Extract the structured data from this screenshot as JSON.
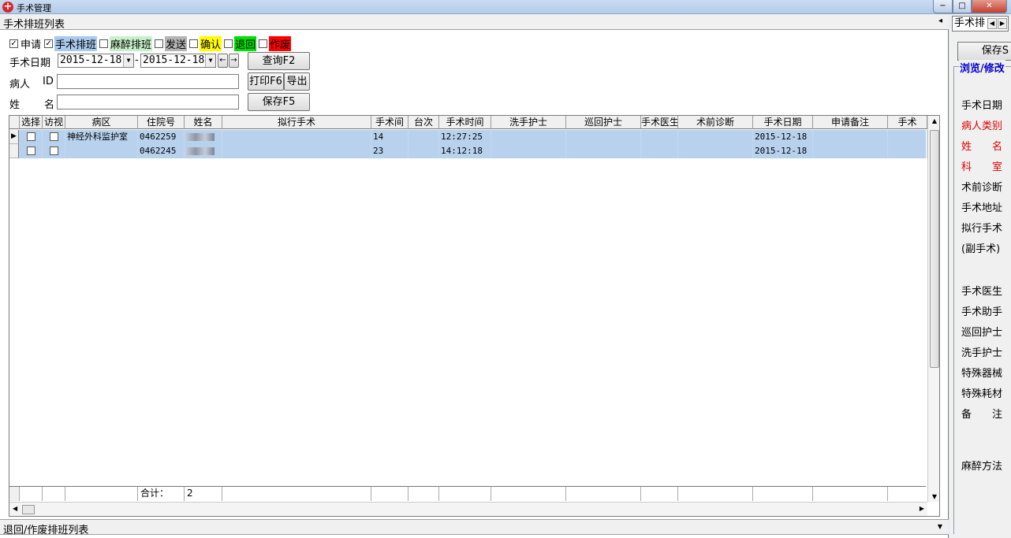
{
  "window": {
    "title": "手术管理",
    "controls": {
      "minimize": "−",
      "maximize": "□",
      "close": "✕"
    }
  },
  "top_panel": {
    "title": "手术排班列表",
    "collapse_glyph": "◂"
  },
  "filters": [
    {
      "label": "申请",
      "checked": true,
      "bg": "transparent",
      "color": "#000000"
    },
    {
      "label": "手术排班",
      "checked": true,
      "bg": "#a9c9ee",
      "color": "#000000"
    },
    {
      "label": "麻醉排班",
      "checked": false,
      "bg": "#c8f0c8",
      "color": "#000000"
    },
    {
      "label": "发送",
      "checked": false,
      "bg": "#b4b4b4",
      "color": "#000000"
    },
    {
      "label": "确认",
      "checked": false,
      "bg": "#ffff00",
      "color": "#000000"
    },
    {
      "label": "退回",
      "checked": false,
      "bg": "#00e000",
      "color": "#000000"
    },
    {
      "label": "作废",
      "checked": false,
      "bg": "#ff0000",
      "color": "#000000"
    }
  ],
  "form": {
    "date_label": "手术日期",
    "date_from": "2015-12-18",
    "date_sep": "-",
    "date_to": "2015-12-18",
    "prev_glyph": "←",
    "next_glyph": "→",
    "patient_label": "病人",
    "patient_id_label": "ID",
    "patient_id_value": "",
    "name_label_1": "姓",
    "name_label_2": "名",
    "name_value": ""
  },
  "buttons": {
    "query": "查询F2",
    "print": "打印F6",
    "export": "导出",
    "save": "保存F5"
  },
  "table": {
    "columns": [
      "选择",
      "访视",
      "病区",
      "住院号",
      "姓名",
      "拟行手术",
      "手术间",
      "台次",
      "手术时间",
      "洗手护士",
      "巡回护士",
      "手术医生",
      "术前诊断",
      "手术日期",
      "申请备注",
      "手术"
    ],
    "rows": [
      {
        "indicator": "▶",
        "ward": "神经外科监护室",
        "admission_no": "0462259",
        "name": "",
        "procedure": "",
        "room": "14",
        "seq": "",
        "time": "12:27:25",
        "scrub_nurse": "",
        "circ_nurse": "",
        "surgeon": "",
        "preop_dx": "",
        "date": "2015-12-18",
        "note": ""
      },
      {
        "indicator": "",
        "ward": "",
        "admission_no": "0462245",
        "name": "",
        "procedure": "",
        "room": "23",
        "seq": "",
        "time": "14:12:18",
        "scrub_nurse": "",
        "circ_nurse": "",
        "surgeon": "",
        "preop_dx": "",
        "date": "2015-12-18",
        "note": ""
      }
    ],
    "total_label": "合计：",
    "total_value": "2"
  },
  "bottom_panel": {
    "title": "退回/作废排班列表",
    "collapse_glyph": "▼"
  },
  "side": {
    "tab_label": "手术排",
    "tab_prev": "◀",
    "tab_next": "▶",
    "save": "保存S",
    "group_title": "浏览/修改",
    "fields": [
      {
        "label": "手术日期",
        "red": false
      },
      {
        "label": "病人类别",
        "red": true
      },
      {
        "label": "姓　　名",
        "red": true
      },
      {
        "label": "科　　室",
        "red": true
      },
      {
        "label": "术前诊断",
        "red": false
      },
      {
        "label": "手术地址",
        "red": false
      },
      {
        "label": "拟行手术",
        "red": false
      },
      {
        "label": "(副手术)",
        "red": false
      },
      {
        "label": "手术医生",
        "red": false
      },
      {
        "label": "手术助手",
        "red": false
      },
      {
        "label": "巡回护士",
        "red": false
      },
      {
        "label": "洗手护士",
        "red": false
      },
      {
        "label": "特殊器械",
        "red": false
      },
      {
        "label": "特殊耗材",
        "red": false
      },
      {
        "label": "备　　注",
        "red": false
      },
      {
        "label": "麻醉方法",
        "red": false
      }
    ]
  },
  "colors": {
    "selected_row": "#b8d2ee",
    "side_group_title": "#0000cc",
    "required_label": "#e00000"
  }
}
